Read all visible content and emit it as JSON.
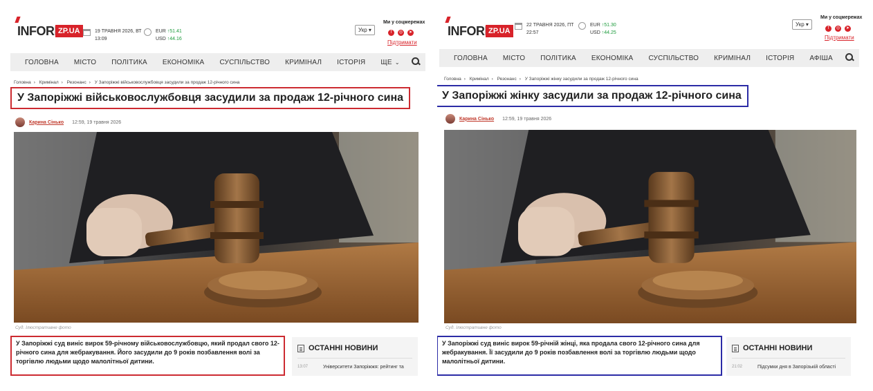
{
  "colors": {
    "brand_red": "#d8232a",
    "left_highlight": "#cc2a30",
    "right_highlight": "#2b2ba6",
    "nav_bg": "#eeeeee",
    "currency_up": "#1a9a3a"
  },
  "panels": [
    {
      "id": "left",
      "logo": {
        "text": "INFORM",
        "box": "ZP.UA"
      },
      "date": {
        "line1": "19 ТРАВНЯ 2026, ВТ",
        "line2": "13:09"
      },
      "fx": [
        {
          "code": "EUR",
          "value": "↑51.41"
        },
        {
          "code": "USD",
          "value": "↑44.16"
        }
      ],
      "lang": "Укр ▾",
      "social_title": "Ми у соцмережах",
      "social_icons": [
        "facebook-icon",
        "instagram-icon",
        "telegram-icon"
      ],
      "support_label": "Підтримати",
      "nav": [
        "ГОЛОВНА",
        "МІСТО",
        "ПОЛІТИКА",
        "ЕКОНОМІКА",
        "СУСПІЛЬСТВО",
        "КРИМІНАЛ",
        "ІСТОРІЯ",
        "ЩЕ"
      ],
      "nav_more_chevron": "⌄",
      "breadcrumb": [
        "Головна",
        "Кримінал",
        "Резонанс",
        "У Запоріжжі військовослужбовця засудили за продаж 12-річного сина"
      ],
      "breadcrumb_sep": "›",
      "headline": "У Запоріжжі військовослужбовця засудили за продаж 12-річного сина",
      "author": "Карина Сінько",
      "datetime": "12:59, 19 травня 2026",
      "photo_caption": "Суд. Ілюстративне фото",
      "lead": "У Запоріжжі суд виніс вирок 59-річному військовослужбовцю, який продал свого 12-річного сина для жебракування. Його засудили до 9 років позбавлення волі за торгівлю людьми щодо малолітньої дитини.",
      "news_box": {
        "title": "ОСТАННІ НОВИНИ",
        "time": "13:07",
        "item": "Університети Запоріжжя: рейтинг та"
      }
    },
    {
      "id": "right",
      "logo": {
        "text": "INFORM",
        "box": "ZP.UA"
      },
      "date": {
        "line1": "22 ТРАВНЯ 2026, ПТ",
        "line2": "22:57"
      },
      "fx": [
        {
          "code": "EUR",
          "value": "↑51.30"
        },
        {
          "code": "USD",
          "value": "↑44.25"
        }
      ],
      "lang": "Укр ▾",
      "social_title": "Ми у соцмережах",
      "social_icons": [
        "facebook-icon",
        "instagram-icon",
        "telegram-icon"
      ],
      "support_label": "Підтримати",
      "nav": [
        "ГОЛОВНА",
        "МІСТО",
        "ПОЛІТИКА",
        "ЕКОНОМІКА",
        "СУСПІЛЬСТВО",
        "КРИМІНАЛ",
        "ІСТОРІЯ",
        "АФІША"
      ],
      "breadcrumb": [
        "Головна",
        "Кримінал",
        "Резонанс",
        "У Запоріжжі жінку засудили за продаж 12-річного сина"
      ],
      "breadcrumb_sep": "›",
      "headline": "У Запоріжжі жінку засудили за продаж 12-річного сина",
      "author": "Карина Сінько",
      "datetime": "12:59, 19 травня 2026",
      "photo_caption": "Суд. Ілюстративне фото",
      "lead": "У Запоріжжі суд виніс вирок 59-річній жінці, яка продала свого 12-річного сина для жебракування. Її засудили до 9 років позбавлення волі за торгівлю людьми щодо малолітньої дитини.",
      "news_box": {
        "title": "ОСТАННІ НОВИНИ",
        "time": "21:02",
        "item": "Підсумки дня в Запорізькій області"
      }
    }
  ]
}
